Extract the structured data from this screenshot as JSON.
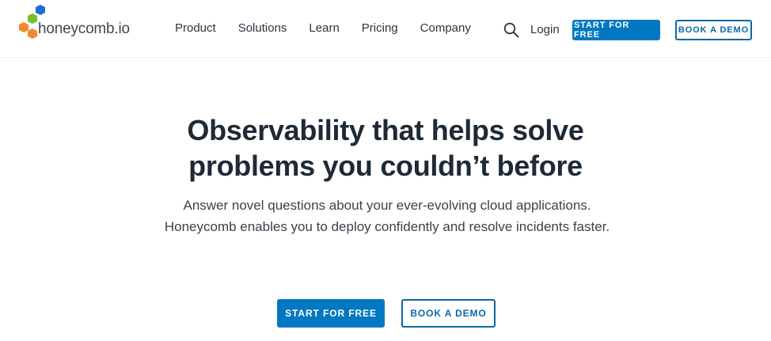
{
  "brand": {
    "name": "honeycomb.io",
    "colors": {
      "blue": "#1f6fd1",
      "green": "#71c12a",
      "orange": "#f0892f",
      "navy": "#0278c2"
    }
  },
  "header": {
    "nav": [
      {
        "label": "Product"
      },
      {
        "label": "Solutions"
      },
      {
        "label": "Learn"
      },
      {
        "label": "Pricing"
      },
      {
        "label": "Company"
      }
    ],
    "search_icon": "search-icon",
    "login_label": "Login",
    "start_label": "START FOR FREE",
    "demo_label": "BOOK A DEMO"
  },
  "hero": {
    "title_line1": "Observability that helps solve",
    "title_line2": "problems you couldn’t before",
    "subtitle": "Answer novel questions about your ever-evolving cloud applications. Honeycomb enables you to deploy confidently and resolve incidents faster.",
    "start_label": "START FOR FREE",
    "demo_label": "BOOK A DEMO"
  }
}
